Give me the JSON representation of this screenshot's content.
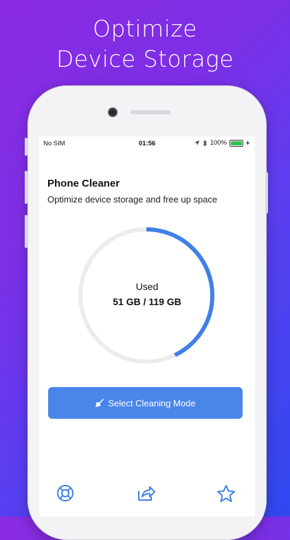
{
  "headline": {
    "line1": "Optimize",
    "line2": "Device Storage"
  },
  "status_bar": {
    "carrier": "No SIM",
    "time": "01:56",
    "battery_percent": "100%"
  },
  "app": {
    "title": "Phone Cleaner",
    "subtitle": "Optimize device storage and free up space"
  },
  "storage": {
    "label": "Used",
    "value_text": "51 GB / 119 GB",
    "used_gb": 51,
    "total_gb": 119,
    "ring_color": "#3f7fe8",
    "track_color": "#ececed"
  },
  "actions": {
    "select_mode_label": "Select Cleaning Mode"
  },
  "tabs": {
    "icons": [
      "lifebuoy-icon",
      "share-icon",
      "star-icon"
    ],
    "color": "#3f7fe8"
  }
}
